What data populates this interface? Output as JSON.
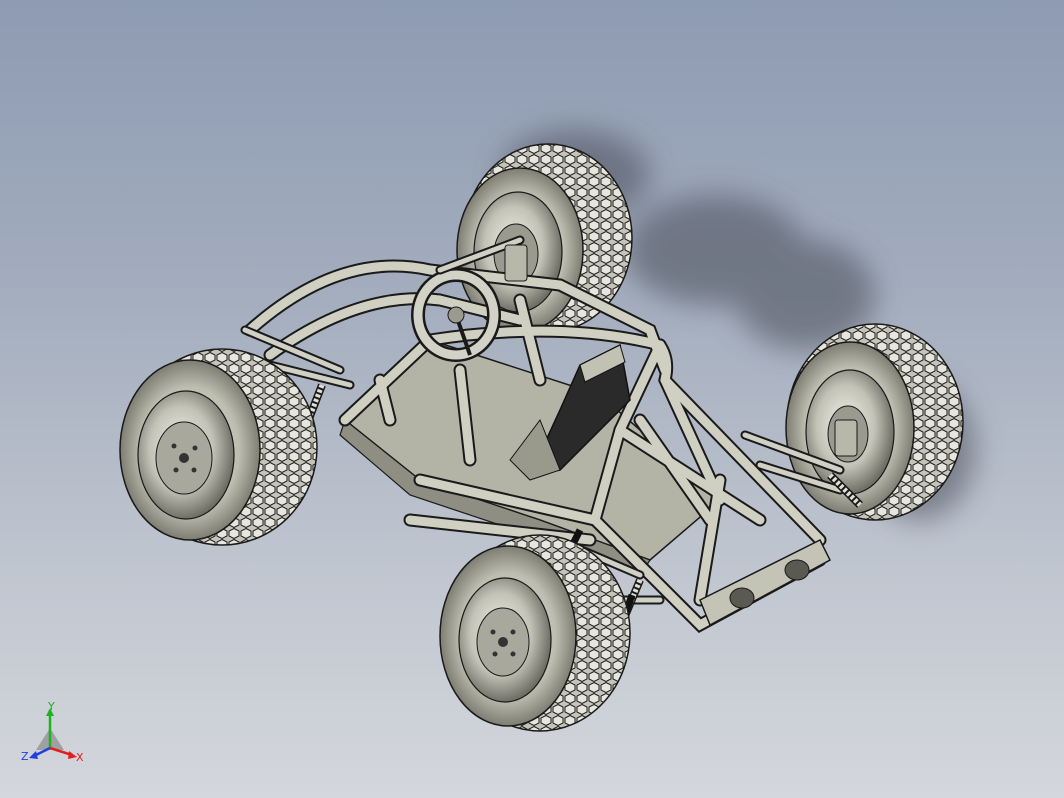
{
  "viewport": {
    "background_top": "#8e9bb3",
    "background_bottom": "#d4d7dc"
  },
  "model": {
    "tire_color": "#b8b8ac",
    "frame_color": "#c9c9bc",
    "seat_color": "#2a2a2a",
    "edge_color": "#1a1a1a"
  },
  "triad": {
    "x_label": "X",
    "y_label": "Y",
    "z_label": "Z",
    "x_color": "#e02020",
    "y_color": "#20b020",
    "z_color": "#2040e0"
  }
}
